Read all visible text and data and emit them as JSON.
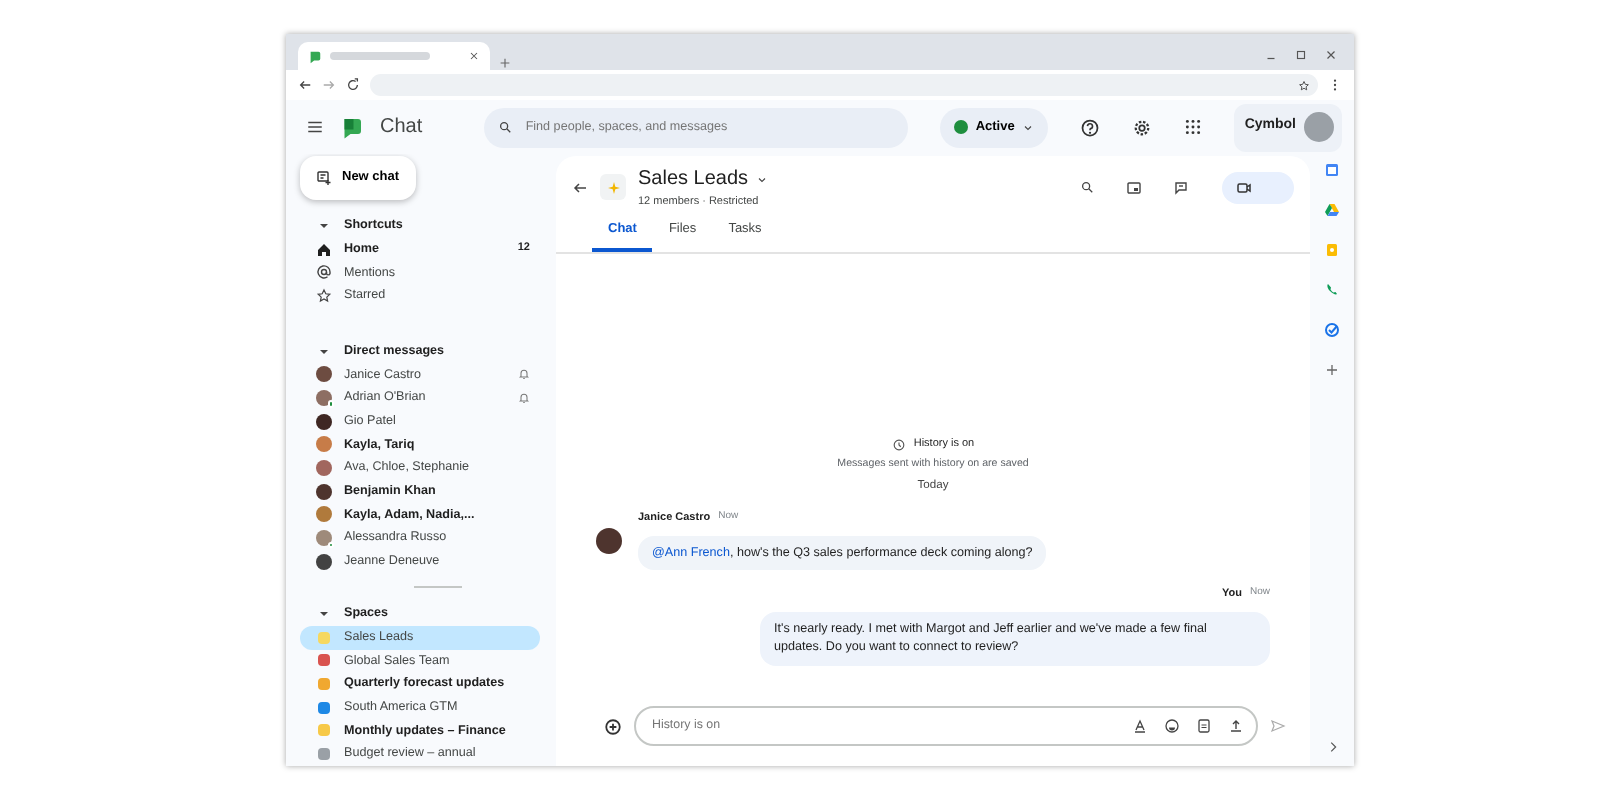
{
  "app": {
    "title": "Chat",
    "search": {
      "placeholder": "Find people, spaces, and messages"
    },
    "status": "Active",
    "org": "Cymbol"
  },
  "new_chat": "New chat",
  "shortcuts": {
    "title": "Shortcuts",
    "expanded": true,
    "items": [
      {
        "label": "Home",
        "count": "12",
        "unread": true
      },
      {
        "label": "Mentions",
        "unread": false
      },
      {
        "label": "Starred",
        "unread": false
      }
    ]
  },
  "direct_messages": {
    "title": "Direct messages",
    "expanded": true,
    "items": [
      {
        "label": "Janice Castro",
        "unread": false,
        "muted": true,
        "online": false,
        "color": "#6d4c41"
      },
      {
        "label": "Adrian O'Brian",
        "unread": false,
        "muted": true,
        "online": true,
        "color": "#8d6e63"
      },
      {
        "label": "Gio Patel",
        "unread": false,
        "muted": false,
        "online": false,
        "color": "#3e2723"
      },
      {
        "label": "Kayla, Tariq",
        "unread": true,
        "muted": false,
        "online": false,
        "color": "#c77c48"
      },
      {
        "label": "Ava, Chloe, Stephanie",
        "unread": false,
        "muted": false,
        "online": false,
        "color": "#a1665e"
      },
      {
        "label": "Benjamin Khan",
        "unread": true,
        "muted": false,
        "online": false,
        "color": "#4e342e"
      },
      {
        "label": "Kayla, Adam, Nadia,...",
        "unread": true,
        "muted": false,
        "online": false,
        "color": "#b07a3c"
      },
      {
        "label": "Alessandra Russo",
        "unread": false,
        "muted": false,
        "online": true,
        "color": "#9e8a7a"
      },
      {
        "label": "Jeanne Deneuve",
        "unread": false,
        "muted": false,
        "online": false,
        "color": "#424242"
      }
    ]
  },
  "spaces": {
    "title": "Spaces",
    "expanded": true,
    "items": [
      {
        "label": "Sales Leads",
        "unread": false,
        "selected": true,
        "color": "#f6d860"
      },
      {
        "label": "Global Sales Team",
        "unread": false,
        "selected": false,
        "color": "#d9534f"
      },
      {
        "label": "Quarterly forecast updates",
        "unread": true,
        "selected": false,
        "color": "#f0a830"
      },
      {
        "label": "South America GTM",
        "unread": false,
        "selected": false,
        "color": "#1e88e5"
      },
      {
        "label": "Monthly updates – Finance",
        "unread": true,
        "selected": false,
        "color": "#f7c948"
      },
      {
        "label": "Budget review – annual",
        "unread": false,
        "selected": false,
        "color": "#9aa0a6"
      }
    ]
  },
  "conversation": {
    "title": "Sales Leads",
    "subtitle": "12 members · Restricted",
    "tabs": [
      {
        "label": "Chat",
        "selected": true
      },
      {
        "label": "Files",
        "selected": false
      },
      {
        "label": "Tasks",
        "selected": false
      }
    ],
    "notice": {
      "title": "History is on",
      "text": "Messages sent with history on are saved",
      "date": "Today"
    },
    "messages": [
      {
        "author": "Janice Castro",
        "time": "Now",
        "mine": false,
        "mention": "@Ann French",
        "text": ", how's the Q3 sales performance deck coming along?"
      },
      {
        "author": "You",
        "time": "Now",
        "mine": true,
        "text": "It's nearly ready. I met with Margot and Jeff earlier and we've made a few final updates. Do you want to connect to review?"
      }
    ],
    "composer": {
      "placeholder": "History is on"
    }
  }
}
